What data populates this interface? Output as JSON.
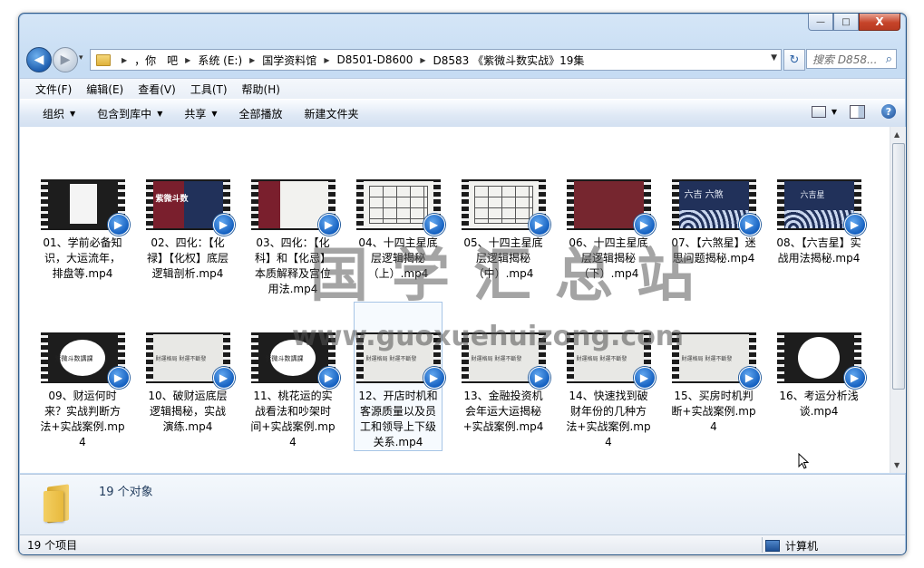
{
  "window": {
    "caption_buttons": {
      "minimize": "—",
      "maximize": "□",
      "close": "X"
    }
  },
  "nav": {
    "back_icon": "◀",
    "forward_icon": "▶",
    "history_icon": "▾",
    "breadcrumbs": [
      "，你　吧",
      "系统 (E:)",
      "国学资料馆",
      "D8501-D8600",
      "D8583 《紫微斗数实战》19集"
    ],
    "refresh_icon": "↻",
    "search_placeholder": "搜索 D858...",
    "search_icon": "⌕"
  },
  "menu": [
    "文件(F)",
    "编辑(E)",
    "查看(V)",
    "工具(T)",
    "帮助(H)"
  ],
  "toolbar": {
    "organize": "组织",
    "include_library": "包含到库中",
    "share": "共享",
    "play_all": "全部播放",
    "new_folder": "新建文件夹",
    "help_icon": "?"
  },
  "files": [
    {
      "name": "01、学前必备知识，大运流年，排盘等.mp4",
      "thumb": "dark"
    },
    {
      "name": "02、四化：【化禄】【化权】底层逻辑剖析.mp4",
      "thumb": "navy-split"
    },
    {
      "name": "03、四化：【化科】和【化忌】本质解释及宫位用法.mp4",
      "thumb": "wine-split"
    },
    {
      "name": "04、十四主星底层逻辑揭秘（上）.mp4",
      "thumb": "grid"
    },
    {
      "name": "05、十四主星底层逻辑揭秘（中）.mp4",
      "thumb": "grid"
    },
    {
      "name": "06、十四主星底层逻辑揭秘（下）.mp4",
      "thumb": "wine"
    },
    {
      "name": "07、【六煞星】迷思问题揭秘.mp4",
      "thumb": "navy-wave"
    },
    {
      "name": "08、【六吉星】实战用法揭秘.mp4",
      "thumb": "navy-wave"
    },
    {
      "name": "09、财运何时来？实战判断方法+实战案例.mp4",
      "thumb": "dark-circle"
    },
    {
      "name": "10、破财运底层逻辑揭秘，实战演练.mp4",
      "thumb": "grey"
    },
    {
      "name": "11、桃花运的实战看法和吵架时间+实战案例.mp4",
      "thumb": "dark-circle"
    },
    {
      "name": "12、开店时机和客源质量以及员工和领导上下级关系.mp4",
      "thumb": "grey"
    },
    {
      "name": "13、金融投资机会年运大运揭秘+实战案例.mp4",
      "thumb": "grey"
    },
    {
      "name": "14、快速找到破财年份的几种方法+实战案例.mp4",
      "thumb": "grey"
    },
    {
      "name": "15、买房时机判断+实战案例.mp4",
      "thumb": "grey"
    },
    {
      "name": "16、考运分析浅谈.mp4",
      "thumb": "dark-circle"
    }
  ],
  "thumb_texts": {
    "t2": "紫微斗数",
    "t7": "六吉 六煞",
    "t8": "六吉星",
    "t9": "紫微斗数講課",
    "t10": "財運格局 財運不斷發",
    "t11": "紫微斗数講課"
  },
  "watermark": {
    "big": "国学汇总站",
    "url": "www.guoxuehuizong.com"
  },
  "details": {
    "count": "19 个对象"
  },
  "status": {
    "items": "19 个项目",
    "location": "计算机"
  },
  "colors": {
    "accent": "#1460c0",
    "titlebar": "#c6dcf3"
  }
}
